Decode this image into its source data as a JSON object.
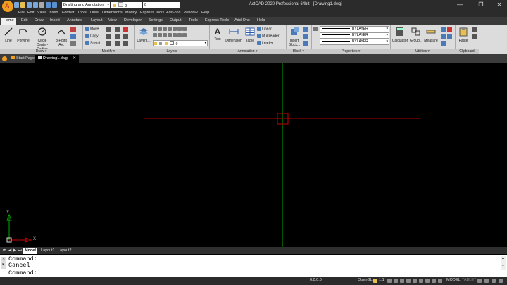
{
  "window": {
    "title": "ActCAD 2020 Professional 64bit - [Drawing1.dwg]",
    "logo_letter": "A",
    "minimize": "—",
    "maximize": "❐",
    "close": "✕"
  },
  "quick_access": {
    "workspace": "Drafting and Annotation",
    "layer": "0",
    "value": "0"
  },
  "menubar": [
    "File",
    "Edit",
    "View",
    "Insert",
    "Format",
    "Tools",
    "Draw",
    "Dimensions",
    "Modify",
    "Express Tools",
    "Add-ons",
    "Window",
    "Help"
  ],
  "ribbon_tabs": [
    "Home",
    "Edit",
    "Draw",
    "Insert",
    "Annotate",
    "Layout",
    "View",
    "Developer",
    "Settings",
    "Output",
    "Tools",
    "Express Tools",
    "Add-Ons",
    "Help"
  ],
  "ribbon": {
    "draw": {
      "title": "Draw ▾",
      "line": "Line",
      "polyline": "Polyline",
      "circle": "Circle",
      "circle2": "Center-Radius",
      "arc": "3-Point",
      "arc2": "Arc"
    },
    "modify": {
      "title": "Modify ▾",
      "move": "Move",
      "copy": "Copy",
      "stretch": "Stretch"
    },
    "layers": {
      "title": "Layers",
      "layers_btn": "Layers...",
      "layer_value": "0"
    },
    "annotation": {
      "title": "Annotation ▾",
      "text": "Text",
      "dimension": "Dimension",
      "table": "Table",
      "linear": "Linear",
      "multileader": "Multileader",
      "leader": "Leader"
    },
    "block": {
      "title": "Block ▾",
      "insert": "Insert",
      "insert2": "Block..."
    },
    "properties": {
      "title": "Properties ▾",
      "color": "BYLAYER",
      "linetype": "BYLAYER",
      "lineweight": "BYLAYER"
    },
    "utilities": {
      "title": "Utilities ▾",
      "calculator": "Calculator",
      "group": "Group...",
      "measure": "Measure"
    },
    "clipboard": {
      "title": "Clipboard",
      "paste": "Paste"
    }
  },
  "doc_tabs": [
    {
      "label": "Start Page"
    },
    {
      "label": "Drawing1.dwg"
    }
  ],
  "canvas": {
    "ucs_x": "X",
    "ucs_y": "Y"
  },
  "layout_tabs": [
    "Model",
    "Layout1",
    "Layout2"
  ],
  "command": {
    "history": [
      "Command:",
      "Cancel"
    ],
    "prompt": "Command:"
  },
  "status": {
    "coords": "0,0,0,0",
    "opengl": "OpenGL",
    "scale": "1:1",
    "model": "MODEL",
    "tablet": "TABLET"
  },
  "colors": {
    "accent_red": "#cc0000",
    "axis_green": "#00aa00",
    "crosshair_red": "#b00000"
  }
}
